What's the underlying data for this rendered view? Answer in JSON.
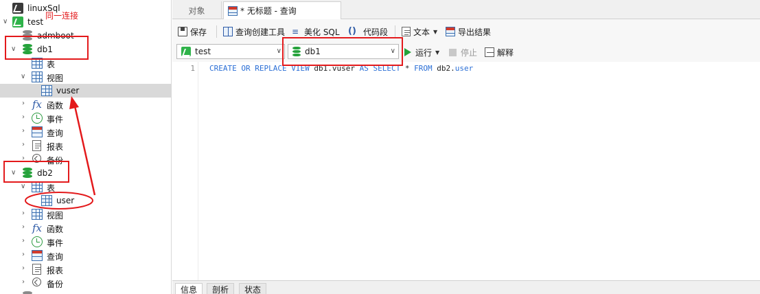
{
  "tabs": {
    "objects": "对象",
    "query": "* 无标题 - 查询"
  },
  "toolbar": {
    "save": "保存",
    "query_builder": "查询创建工具",
    "beautify": "美化 SQL",
    "snippet": "代码段",
    "text": "文本",
    "export": "导出结果"
  },
  "controls": {
    "connection": "test",
    "database": "db1",
    "run": "运行",
    "stop": "停止",
    "explain": "解释"
  },
  "editor": {
    "line_number": "1",
    "tokens": [
      "CREATE",
      "OR",
      "REPLACE",
      "VIEW",
      "db1.vuser",
      "AS",
      "SELECT",
      "*",
      "FROM",
      "db2.",
      "user"
    ]
  },
  "bottom_tabs": [
    "信息",
    "剖析",
    "状态"
  ],
  "tree": {
    "linux_conn": "linuxSql",
    "test_conn": "test",
    "admboot": "admboot",
    "db1": "db1",
    "db1_tables": "表",
    "db1_views": "视图",
    "vuser": "vuser",
    "db1_functions": "函数",
    "db1_events": "事件",
    "db1_queries": "查询",
    "db1_reports": "报表",
    "db1_backups": "备份",
    "db2": "db2",
    "db2_tables": "表",
    "user": "user",
    "db2_views": "视图",
    "db2_functions": "函数",
    "db2_events": "事件",
    "db2_queries": "查询",
    "db2_reports": "报表",
    "db2_backups": "备份"
  },
  "annotation": {
    "note": "同一连接",
    "color": "#e3191b"
  }
}
